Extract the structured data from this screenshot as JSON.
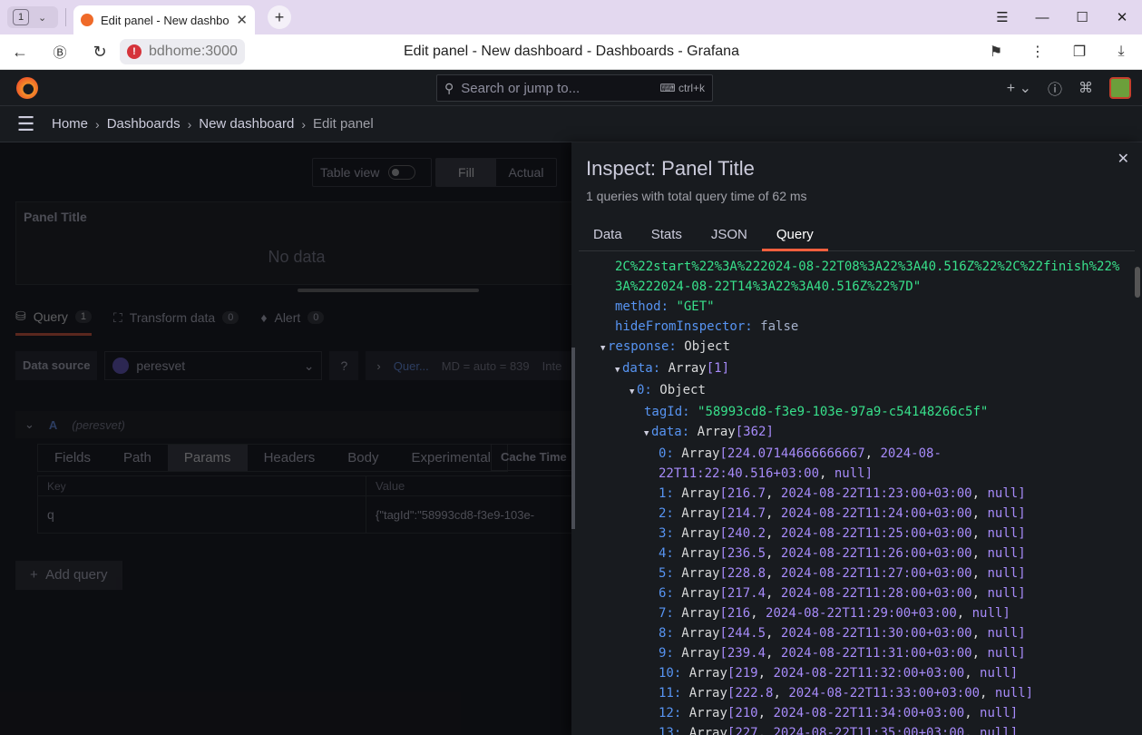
{
  "browser": {
    "tab_count": "1",
    "tab_title": "Edit panel - New dashboard",
    "url_host": "bdhome:3000",
    "page_title": "Edit panel - New dashboard - Dashboards - Grafana"
  },
  "topnav": {
    "search_placeholder": "Search or jump to...",
    "search_shortcut": "ctrl+k"
  },
  "breadcrumb": [
    "Home",
    "Dashboards",
    "New dashboard",
    "Edit panel"
  ],
  "editor": {
    "table_view_label": "Table view",
    "fill_label": "Fill",
    "actual_label": "Actual",
    "panel_title": "Panel Title",
    "no_data": "No data",
    "tabs": [
      {
        "label": "Query",
        "count": "1"
      },
      {
        "label": "Transform data",
        "count": "0"
      },
      {
        "label": "Alert",
        "count": "0"
      }
    ],
    "data_source_label": "Data source",
    "data_source_value": "peresvet",
    "query_options_label": "Quer...",
    "query_options_meta": "MD = auto = 839",
    "query_options_more": "Inte",
    "query_ref": "A",
    "query_ds": "(peresvet)",
    "subtabs": [
      "Fields",
      "Path",
      "Params",
      "Headers",
      "Body",
      "Experimental"
    ],
    "cache_time_label": "Cache Time",
    "params_table": {
      "headers": [
        "Key",
        "Value"
      ],
      "rows": [
        {
          "key": "q",
          "value": "{\"tagId\":\"58993cd8-f3e9-103e-"
        }
      ]
    },
    "add_query_label": "Add query"
  },
  "inspect": {
    "title": "Inspect: Panel Title",
    "subtitle": "1 queries with total query time of 62 ms",
    "tabs": [
      "Data",
      "Stats",
      "JSON",
      "Query"
    ],
    "active_tab": "Query",
    "url_line1": "2C%22start%22%3A%222024-08-22T08%3A22%3A40.516Z%22%2C%22finish%22%",
    "url_line2": "3A%222024-08-22T14%3A22%3A40.516Z%22%7D\"",
    "method_value": "\"GET\"",
    "hide_value": "false",
    "tag_id_value": "\"58993cd8-f3e9-103e-97a9-c54148266c5f\"",
    "array_len_data": "[1]",
    "array_len_inner": "[362]",
    "first_row": {
      "idx": "0:",
      "value": "224.07144666666667",
      "ts_a": "2024-08-",
      "ts_b": "22T11:22:40.516+03:00"
    },
    "rows": [
      {
        "idx": "1:",
        "value": "216.7",
        "ts": "2024-08-22T11:23:00+03:00"
      },
      {
        "idx": "2:",
        "value": "214.7",
        "ts": "2024-08-22T11:24:00+03:00"
      },
      {
        "idx": "3:",
        "value": "240.2",
        "ts": "2024-08-22T11:25:00+03:00"
      },
      {
        "idx": "4:",
        "value": "236.5",
        "ts": "2024-08-22T11:26:00+03:00"
      },
      {
        "idx": "5:",
        "value": "228.8",
        "ts": "2024-08-22T11:27:00+03:00"
      },
      {
        "idx": "6:",
        "value": "217.4",
        "ts": "2024-08-22T11:28:00+03:00"
      },
      {
        "idx": "7:",
        "value": "216",
        "ts": "2024-08-22T11:29:00+03:00"
      },
      {
        "idx": "8:",
        "value": "244.5",
        "ts": "2024-08-22T11:30:00+03:00"
      },
      {
        "idx": "9:",
        "value": "239.4",
        "ts": "2024-08-22T11:31:00+03:00"
      },
      {
        "idx": "10:",
        "value": "219",
        "ts": "2024-08-22T11:32:00+03:00"
      },
      {
        "idx": "11:",
        "value": "222.8",
        "ts": "2024-08-22T11:33:00+03:00"
      },
      {
        "idx": "12:",
        "value": "210",
        "ts": "2024-08-22T11:34:00+03:00"
      },
      {
        "idx": "13:",
        "value": "227",
        "ts": "2024-08-22T11:35:00+03:00"
      }
    ]
  }
}
